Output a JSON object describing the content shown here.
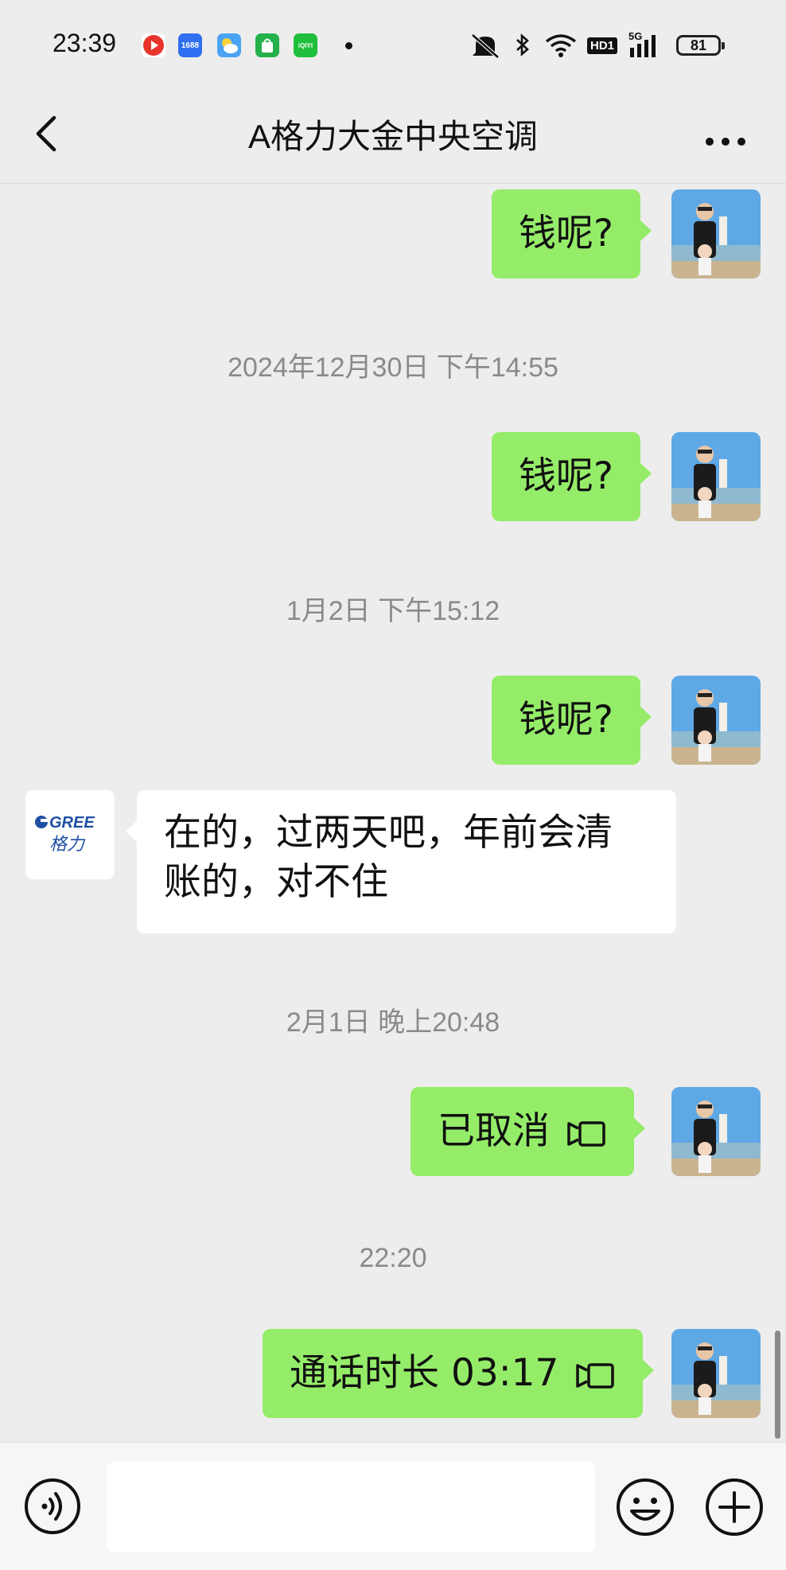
{
  "status_bar": {
    "time": "23:39",
    "apps": [
      {
        "icon": "video-app-icon",
        "color": "#e8342b",
        "label": "▶"
      },
      {
        "icon": "1688-app-icon",
        "color": "#2f6ff0",
        "label": "1688"
      },
      {
        "icon": "weather-app-icon",
        "color": "#4aa3f3",
        "label": "☁"
      },
      {
        "icon": "shopping-bag-app-icon",
        "color": "#25b14a",
        "label": "⬢"
      },
      {
        "icon": "iqiyi-app-icon",
        "color": "#1fbf3c",
        "label": "iQIYI"
      }
    ],
    "network": "5G",
    "hd_label": "HD1",
    "battery": "81"
  },
  "header": {
    "back_icon": "chevron-left-icon",
    "title": "A格力大金中央空调",
    "more_icon": "more-dots-icon"
  },
  "colors": {
    "background": "#ededed",
    "my_bubble": "#95ec69",
    "their_bubble": "#ffffff",
    "timestamp": "#8a8a8a"
  },
  "messages": {
    "m1": {
      "text": "钱呢?"
    },
    "t1": "2024年12月30日 下午14:55",
    "m2": {
      "text": "钱呢?"
    },
    "t2": "1月2日 下午15:12",
    "m3": {
      "text": "钱呢?"
    },
    "m4": {
      "sender_logo": "GREE",
      "sender_logo_sub": "格力",
      "line1": "在的，过两天吧，年前会清",
      "line2": "账的，对不住"
    },
    "t3": "2月1日 晚上20:48",
    "m5": {
      "text": "已取消",
      "icon": "video-call-icon"
    },
    "t4": "22:20",
    "m6": {
      "text": "通话时长 03:17",
      "icon": "video-call-icon"
    }
  },
  "input_bar": {
    "voice_icon": "voice-input-icon",
    "placeholder": "",
    "emoji_icon": "emoji-icon",
    "plus_icon": "plus-circle-icon"
  }
}
